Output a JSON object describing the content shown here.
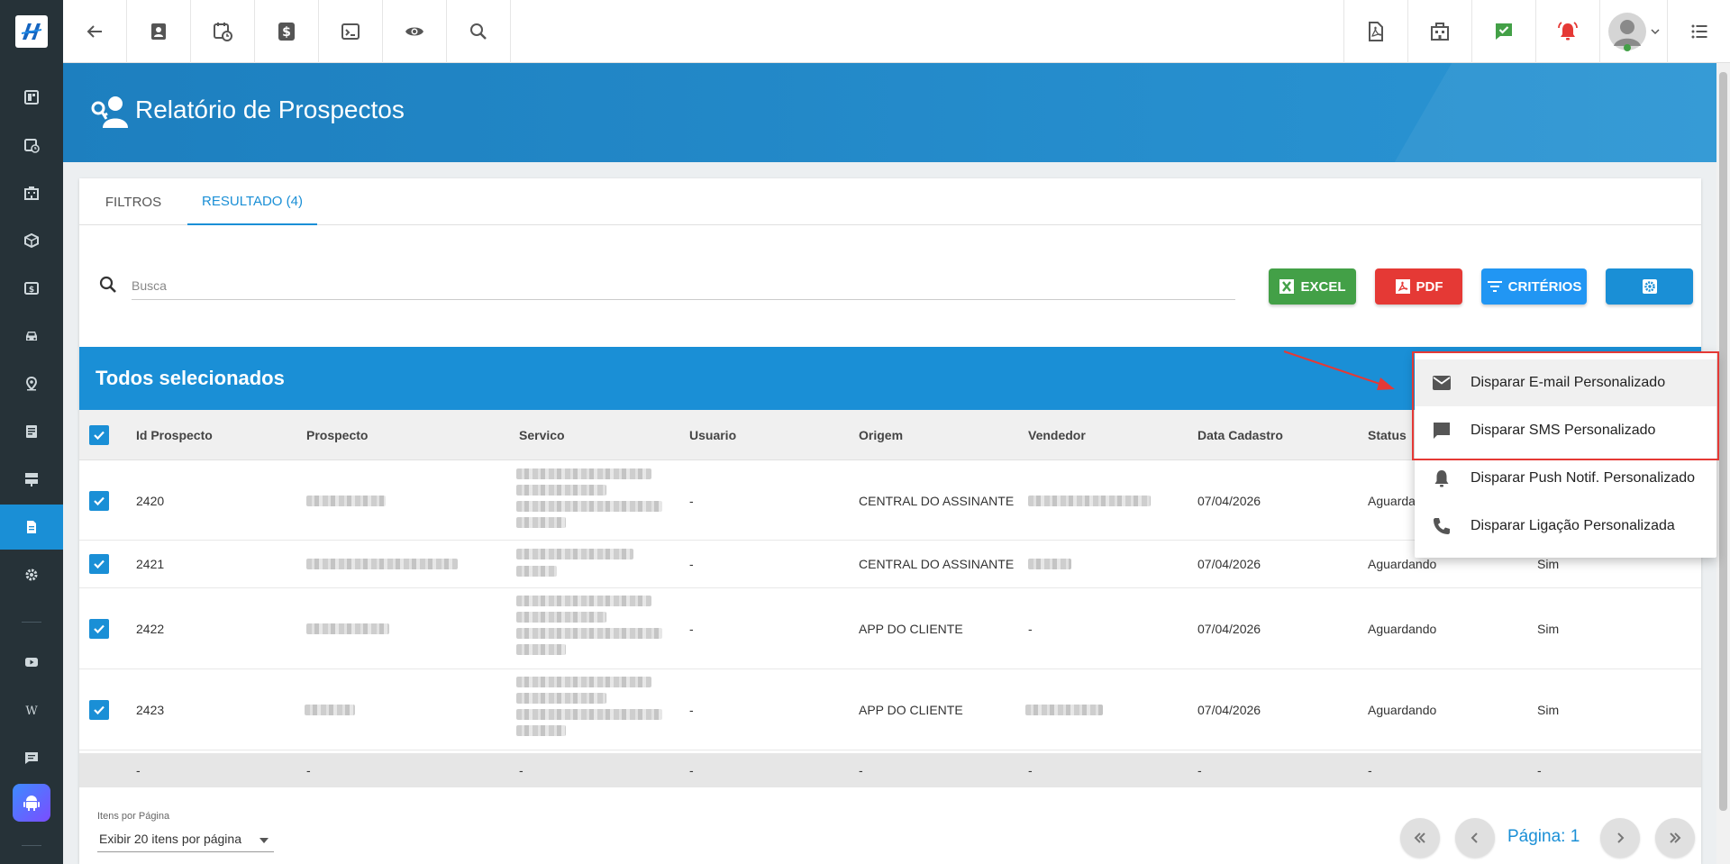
{
  "page": {
    "title": "Relatório de Prospectos"
  },
  "tabs": [
    {
      "label": "FILTROS"
    },
    {
      "label": "RESULTADO (4)"
    }
  ],
  "search": {
    "placeholder": "Busca",
    "value": ""
  },
  "buttons": {
    "excel": "EXCEL",
    "pdf": "PDF",
    "criterios": "CRITÉRIOS"
  },
  "selection_banner": "Todos selecionados",
  "table": {
    "columns": [
      "Id Prospecto",
      "Prospecto",
      "Servico",
      "Usuario",
      "Origem",
      "Vendedor",
      "Data Cadastro",
      "Status"
    ],
    "rows": [
      {
        "id": "2420",
        "usuario": "-",
        "origem": "CENTRAL DO ASSINANTE",
        "data": "07/04/2026",
        "status": "Aguardan"
      },
      {
        "id": "2421",
        "usuario": "-",
        "origem": "CENTRAL DO ASSINANTE",
        "data": "07/04/2026",
        "status": "Aguardando",
        "extra": "Sim"
      },
      {
        "id": "2422",
        "usuario": "-",
        "origem": "APP DO CLIENTE",
        "vendedor": "-",
        "data": "07/04/2026",
        "status": "Aguardando",
        "extra": "Sim"
      },
      {
        "id": "2423",
        "usuario": "-",
        "origem": "APP DO CLIENTE",
        "data": "07/04/2026",
        "status": "Aguardando",
        "extra": "Sim"
      }
    ],
    "footer": [
      "-",
      "-",
      "-",
      "-",
      "-",
      "-",
      "-",
      "-",
      "-"
    ]
  },
  "pagination": {
    "per_page_label": "Itens por Página",
    "per_page_value": "Exibir 20 itens por página",
    "page_label": "Página: 1"
  },
  "menu": [
    {
      "label": "Disparar E-mail Personalizado",
      "icon": "email-icon"
    },
    {
      "label": "Disparar SMS Personalizado",
      "icon": "sms-icon"
    },
    {
      "label": "Disparar Push Notif. Personalizado",
      "icon": "bell-icon"
    },
    {
      "label": "Disparar Ligação Personalizada",
      "icon": "phone-icon"
    }
  ],
  "colors": {
    "primary": "#1a8fd6",
    "sidebar": "#263238",
    "excel": "#43a047",
    "pdf": "#e53935",
    "criterios": "#2196f3"
  }
}
